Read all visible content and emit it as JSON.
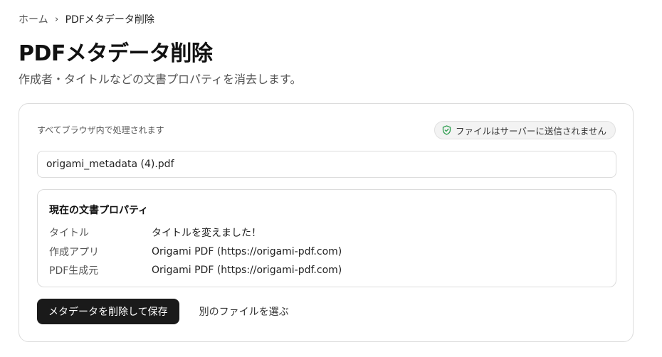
{
  "breadcrumb": {
    "home": "ホーム",
    "separator": "›",
    "current": "PDFメタデータ削除"
  },
  "page": {
    "title": "PDFメタデータ削除",
    "subtitle": "作成者・タイトルなどの文書プロパティを消去します。"
  },
  "card": {
    "note": "すべてブラウザ内で処理されます",
    "badge": {
      "icon": "shield-check-icon",
      "text": "ファイルはサーバーに送信されません",
      "accent": "#2e9e4f"
    },
    "file_name": "origami_metadata (4).pdf",
    "properties": {
      "title": "現在の文書プロパティ",
      "rows": [
        {
          "key": "タイトル",
          "value": "タイトルを変えました！"
        },
        {
          "key": "作成アプリ",
          "value": "Origami PDF (https://origami-pdf.com)"
        },
        {
          "key": "PDF生成元",
          "value": "Origami PDF (https://origami-pdf.com)"
        }
      ]
    },
    "actions": {
      "primary": "メタデータを削除して保存",
      "secondary": "別のファイルを選ぶ"
    }
  }
}
